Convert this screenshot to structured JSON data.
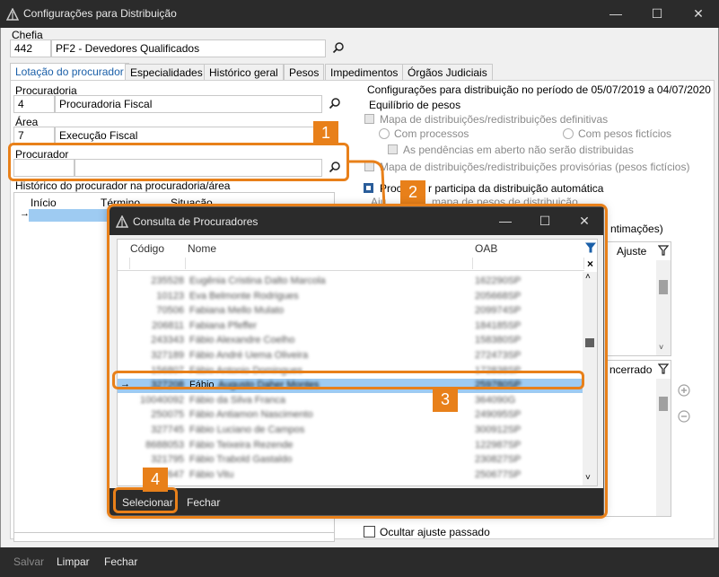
{
  "window": {
    "title": "Configurações para Distribuição"
  },
  "chefia": {
    "label": "Chefia",
    "code": "442",
    "name": "PF2 - Devedores Qualificados"
  },
  "tabs": [
    {
      "label": "Lotação do procurador"
    },
    {
      "label": "Especialidades"
    },
    {
      "label": "Histórico geral"
    },
    {
      "label": "Pesos"
    },
    {
      "label": "Impedimentos"
    },
    {
      "label": "Órgãos Judiciais"
    }
  ],
  "procuradoria": {
    "label": "Procuradoria",
    "code": "4",
    "name": "Procuradoria Fiscal"
  },
  "area": {
    "label": "Área",
    "code": "7",
    "name": "Execução Fiscal"
  },
  "procurador": {
    "label": "Procurador",
    "code": "",
    "name": ""
  },
  "historico": {
    "label": "Histórico do procurador na procuradoria/área",
    "columns": [
      "Início",
      "Término",
      "Situação"
    ]
  },
  "config": {
    "period_text": "Configurações para distribuição no período de 05/07/2019 a 04/07/2020",
    "equilibrio_label": "Equilíbrio de pesos",
    "mapa_definitivas": "Mapa de distribuições/redistribuições definitivas",
    "com_processos": "Com processos",
    "com_pesos_ficticios": "Com pesos fictícios",
    "pendencias": "As pendências em aberto não serão distribuidas",
    "mapa_provisorias": "Mapa de distribuições/redistribuições provisórias (pesos fictícios)",
    "participa_prefix": "Proc",
    "participa_suffix": "r participa da distribuição automática",
    "ajuste_partial": "Aju",
    "ajuste_partial_right": "mapa de pesos de distribuição",
    "intimacoes_partial": "ntimações)",
    "ajuste_col": "Ajuste",
    "encerrado_col": "ncerrado",
    "ocultar_ajuste": "Ocultar ajuste passado"
  },
  "bottom": {
    "salvar": "Salvar",
    "limpar": "Limpar",
    "fechar": "Fechar"
  },
  "dialog": {
    "title": "Consulta de Procuradores",
    "columns": {
      "codigo": "Código",
      "nome": "Nome",
      "oab": "OAB"
    },
    "rows": [
      {
        "codigo": "235528",
        "nome": "Eugênia Cristina Dalto Marcola",
        "oab": "162290SP"
      },
      {
        "codigo": "10123",
        "nome": "Eva Belmonte Rodrigues",
        "oab": "205668SP"
      },
      {
        "codigo": "70506",
        "nome": "Fabiana Mello Mulato",
        "oab": "209974SP"
      },
      {
        "codigo": "206811",
        "nome": "Fabiana Pfeffer",
        "oab": "184185SP"
      },
      {
        "codigo": "243343",
        "nome": "Fábio Alexandre Coelho",
        "oab": "158380SP"
      },
      {
        "codigo": "327189",
        "nome": "Fábio André Uema Oliveira",
        "oab": "272473SP"
      },
      {
        "codigo": "156807",
        "nome": "Fábio Antonio Domingues",
        "oab": "172838SP"
      },
      {
        "codigo": "327208",
        "nome": "Fábio Augusto Daher Montes",
        "oab": "259780SP",
        "name_visible": "Fábio"
      },
      {
        "codigo": "10040092",
        "nome": "Fábio da Silva Franca",
        "oab": "364090G"
      },
      {
        "codigo": "250075",
        "nome": "Fábio Antiamon Nascimento",
        "oab": "249095SP"
      },
      {
        "codigo": "327745",
        "nome": "Fábio Luciano de Campos",
        "oab": "300912SP"
      },
      {
        "codigo": "8688053",
        "nome": "Fábio Teixeira Rezende",
        "oab": "122987SP"
      },
      {
        "codigo": "321795",
        "nome": "Fábio Trabold Gastaldo",
        "oab": "230827SP"
      },
      {
        "codigo": "327647",
        "nome": "Fábio Vitu",
        "oab": "250677SP"
      }
    ],
    "selected_index": 7,
    "buttons": {
      "selecionar": "Selecionar",
      "fechar": "Fechar"
    }
  },
  "callouts": [
    "1",
    "2",
    "3",
    "4"
  ],
  "colors": {
    "accent": "#e8801a",
    "titlebar": "#2b2b2b",
    "selection": "#9ecbf2",
    "tab_active": "#1a5fa8"
  }
}
